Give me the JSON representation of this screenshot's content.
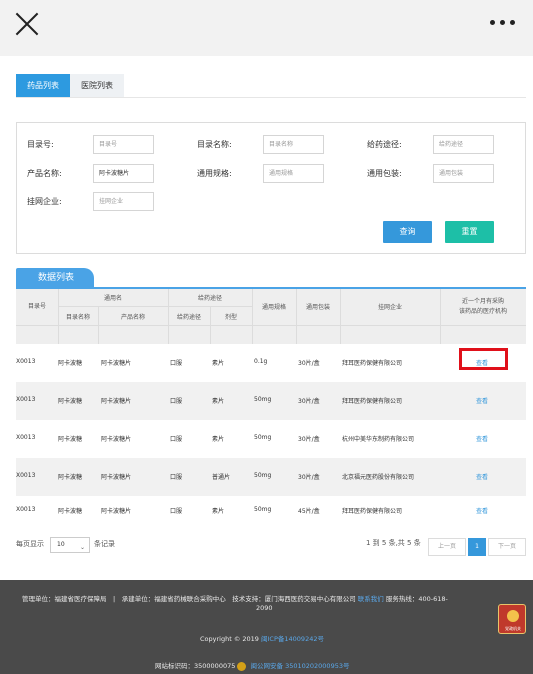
{
  "tabs": {
    "drugs": "药品列表",
    "hospitals": "医院列表"
  },
  "filters": {
    "catalog_no": {
      "label": "目录号:",
      "placeholder": "目录号"
    },
    "catalog_name": {
      "label": "目录名称:",
      "placeholder": "目录名称"
    },
    "route": {
      "label": "给药途径:",
      "placeholder": "给药途径"
    },
    "product_name": {
      "label": "产品名称:",
      "value": "阿卡波糖片"
    },
    "spec": {
      "label": "通用规格:",
      "placeholder": "通用规格"
    },
    "packaging": {
      "label": "通用包装:",
      "placeholder": "通用包装"
    },
    "company": {
      "label": "挂网企业:",
      "placeholder": "挂网企业"
    },
    "query_label": "查询",
    "reset_label": "重置"
  },
  "list_title": "数据列表",
  "table": {
    "headers": {
      "catalog_no": "目录号",
      "generic_name": "通用名",
      "catalog_name": "目录名称",
      "product_name": "产品名称",
      "route_group": "给药途径",
      "route": "给药途径",
      "dosage": "剂型",
      "spec": "通用规格",
      "packaging": "通用包装",
      "company": "挂网企业",
      "recent_line1": "近一个月有采购",
      "recent_line2": "该药品的医疗机构"
    },
    "rows": [
      {
        "no": "X0013",
        "cat": "阿卡波糖",
        "prod": "阿卡波糖片",
        "route": "口服",
        "dose": "素片",
        "spec": "0.1g",
        "pack": "30片/盒",
        "co": "拜耳医药保健有限公司",
        "view": "查看"
      },
      {
        "no": "X0013",
        "cat": "阿卡波糖",
        "prod": "阿卡波糖片",
        "route": "口服",
        "dose": "素片",
        "spec": "50mg",
        "pack": "30片/盒",
        "co": "拜耳医药保健有限公司",
        "view": "查看"
      },
      {
        "no": "X0013",
        "cat": "阿卡波糖",
        "prod": "阿卡波糖片",
        "route": "口服",
        "dose": "素片",
        "spec": "50mg",
        "pack": "30片/盒",
        "co": "杭州中美华东制药有限公司",
        "view": "查看"
      },
      {
        "no": "X0013",
        "cat": "阿卡波糖",
        "prod": "阿卡波糖片",
        "route": "口服",
        "dose": "普通片",
        "spec": "50mg",
        "pack": "30片/盒",
        "co": "北京福元医药股份有限公司",
        "view": "查看"
      },
      {
        "no": "X0013",
        "cat": "阿卡波糖",
        "prod": "阿卡波糖片",
        "route": "口服",
        "dose": "素片",
        "spec": "50mg",
        "pack": "45片/盒",
        "co": "拜耳医药保健有限公司",
        "view": "查看"
      }
    ]
  },
  "pager": {
    "per_page_label": "每页显示",
    "per_page_value": "10",
    "records_label": "条记录",
    "summary": "1 到 5 条,共 5 条",
    "prev": "上一页",
    "current": "1",
    "next": "下一页"
  },
  "footer": {
    "line1_a": "管理单位：福建省医疗保障局　|　承建单位：福建省药械联合采购中心　技术支持：厦门海西医药交易中心有限公司",
    "contact": "联系我们",
    "line1_b": "服务热线：400-618-",
    "line1_c": "2090",
    "copyright": "Copyright © 2019",
    "icp": "闽ICP备14009242号",
    "site_id": "网站标识码：3500000075",
    "police": "闽公网安备 35010202000953号",
    "badge_text": "党政机关"
  }
}
